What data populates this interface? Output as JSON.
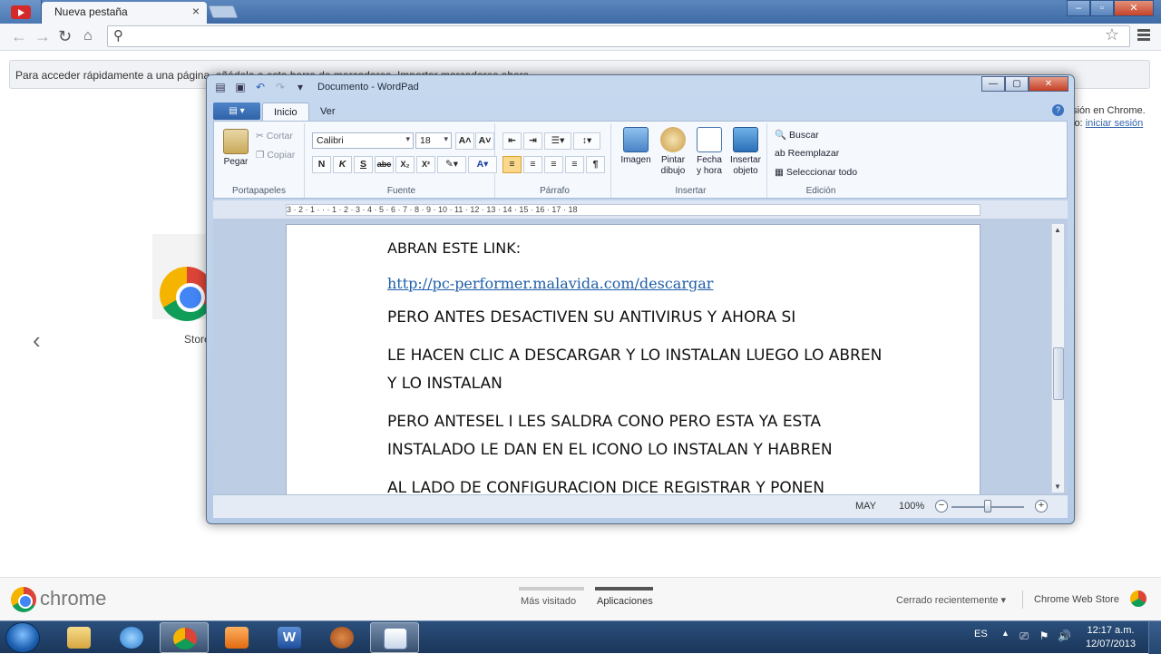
{
  "chrome": {
    "tab_title": "Nueva pestaña",
    "close_tab": "×",
    "window_controls": {
      "minimize": "–",
      "maximize": "▫",
      "close": "✕"
    },
    "bookmark_bar_text": "Para acceder rápidamente a una página, añádela a esta barra de marcadores. Importar marcadores ahora...",
    "signin_line1": "sión en Chrome.",
    "signin_line2_prefix": "lo: ",
    "signin_link": "iniciar sesión",
    "store_label": "Store",
    "prev_arrow": "‹",
    "chrome_wordmark": "chrome",
    "ntp_tabs": [
      "Más visitado",
      "Aplicaciones"
    ],
    "recently_closed": "Cerrado recientemente ▾",
    "web_store": "Chrome Web Store",
    "icons": [
      "youtube-icon",
      "back-icon",
      "forward-icon",
      "reload-icon",
      "home-icon",
      "search-icon",
      "star-icon",
      "menu-icon"
    ]
  },
  "wordpad": {
    "title": "Documento - WordPad",
    "window_controls": {
      "minimize": "—",
      "maximize": "▢",
      "close": "✕"
    },
    "tabs": [
      "Inicio",
      "Ver"
    ],
    "app_menu_label": "▤ ▾",
    "help": "?",
    "clipboard": {
      "paste": "Pegar",
      "cut": "Cortar",
      "copy": "Copiar",
      "group": "Portapapeles"
    },
    "font": {
      "family": "Calibri",
      "size": "18",
      "grow": "A˄",
      "shrink": "A˅",
      "group": "Fuente",
      "format_buttons": [
        "N",
        "K",
        "S",
        "abc",
        "X₂",
        "X²",
        "✎▾",
        "A▾"
      ]
    },
    "paragraph": {
      "group": "Párrafo",
      "align_buttons": [
        "≡",
        "≡",
        "≡",
        "≡",
        "¶"
      ]
    },
    "insert": {
      "image": "Imagen",
      "paint_line1": "Pintar",
      "paint_line2": "dibujo",
      "datetime_line1": "Fecha",
      "datetime_line2": "y hora",
      "object_line1": "Insertar",
      "object_line2": "objeto",
      "group": "Insertar"
    },
    "editing": {
      "find": "Buscar",
      "replace": "Reemplazar",
      "select_all": "Seleccionar todo",
      "group": "Edición"
    },
    "ruler": "3 · 2 · 1 · · · 1 · 2 · 3 · 4 · 5 · 6 · 7 · 8 · 9 · 10 · 11 · 12 · 13 · 14 · 15 · 16 · 17 · 18",
    "document": {
      "line1": "ABRAN ESTE LINK:",
      "link": "http://pc-performer.malavida.com/descargar",
      "para1": "PERO ANTES DESACTIVEN SU ANTIVIRUS Y AHORA SI",
      "para2": " LE HACEN CLIC A DESCARGAR Y LO INSTALAN LUEGO LO ABREN Y LO INSTALAN",
      "para3": "PERO ANTESEL I LES SALDRA CONO PERO ESTA YA ESTA INSTALADO LE DAN EN EL ICONO LO INSTALAN Y HABREN",
      "para4": "AL LADO DE CONFIGURACION DICE REGISTRAR Y PONEN"
    },
    "status": {
      "caps": "MAY",
      "zoom": "100%",
      "zoom_out": "−",
      "zoom_in": "+"
    }
  },
  "taskbar": {
    "language": "ES",
    "tray_arrow": "▲",
    "time": "12:17 a.m.",
    "date": "12/07/2013",
    "apps": [
      "explorer",
      "internet-explorer",
      "chrome",
      "media-player",
      "word",
      "baseball-glove-app",
      "wordpad"
    ]
  }
}
